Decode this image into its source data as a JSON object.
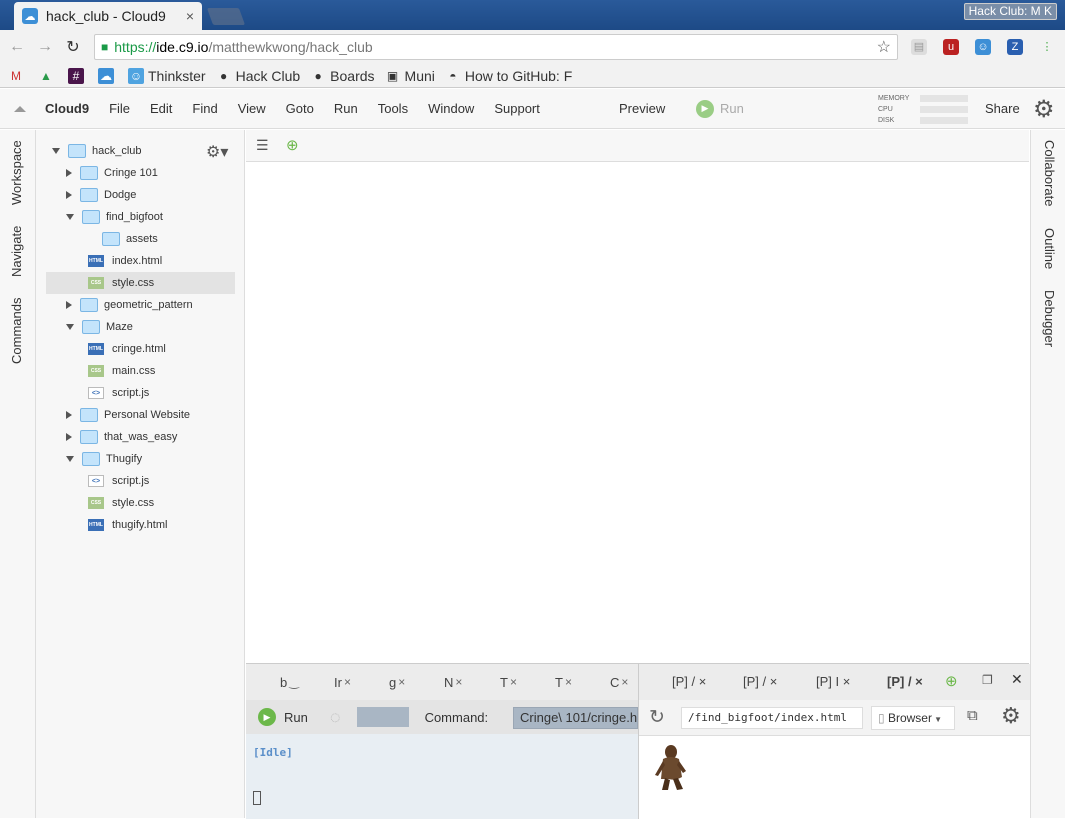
{
  "chrome": {
    "tab_title": "hack_club - Cloud9",
    "tab_close": "×",
    "profile": "Hack Club: M K",
    "url_https": "https://",
    "url_host": "ide.c9.io",
    "url_path": "/matthewkwong/hack_club"
  },
  "bookmarks": [
    {
      "label": "",
      "icon": "gmail-icon"
    },
    {
      "label": "",
      "icon": "drive-icon"
    },
    {
      "label": "",
      "icon": "slack-icon"
    },
    {
      "label": "",
      "icon": "cloud9-icon"
    },
    {
      "label": "Thinkster",
      "icon": "thinkster-icon"
    },
    {
      "label": "Hack Club",
      "icon": "github-icon"
    },
    {
      "label": "Boards",
      "icon": "github-icon"
    },
    {
      "label": "Muni",
      "icon": "muni-icon"
    },
    {
      "label": "How to GitHub: F",
      "icon": "incognito-icon"
    }
  ],
  "menu": {
    "brand": "Cloud9",
    "items": [
      "File",
      "Edit",
      "Find",
      "View",
      "Goto",
      "Run",
      "Tools",
      "Window",
      "Support"
    ],
    "preview": "Preview",
    "run": "Run",
    "share": "Share",
    "stats": [
      "MEMORY",
      "CPU",
      "DISK"
    ]
  },
  "left_tabs": [
    "Workspace",
    "Navigate",
    "Commands"
  ],
  "right_tabs": [
    "Collaborate",
    "Outline",
    "Debugger"
  ],
  "tree": [
    {
      "label": "hack_club",
      "kind": "folder",
      "depth": 0,
      "open": true
    },
    {
      "label": "Cringe 101",
      "kind": "folder",
      "depth": 1,
      "open": false
    },
    {
      "label": "Dodge",
      "kind": "folder",
      "depth": 1,
      "open": false
    },
    {
      "label": "find_bigfoot",
      "kind": "folder",
      "depth": 1,
      "open": true
    },
    {
      "label": "assets",
      "kind": "folder",
      "depth": 2
    },
    {
      "label": "index.html",
      "kind": "html",
      "depth": 2
    },
    {
      "label": "style.css",
      "kind": "css",
      "depth": 2,
      "selected": true
    },
    {
      "label": "geometric_pattern",
      "kind": "folder",
      "depth": 1,
      "open": false
    },
    {
      "label": "Maze",
      "kind": "folder",
      "depth": 1,
      "open": true
    },
    {
      "label": "cringe.html",
      "kind": "html",
      "depth": 2
    },
    {
      "label": "main.css",
      "kind": "css",
      "depth": 2
    },
    {
      "label": "script.js",
      "kind": "js",
      "depth": 2
    },
    {
      "label": "Personal Website",
      "kind": "folder",
      "depth": 1,
      "open": false
    },
    {
      "label": "that_was_easy",
      "kind": "folder",
      "depth": 1,
      "open": false
    },
    {
      "label": "Thugify",
      "kind": "folder",
      "depth": 1,
      "open": true
    },
    {
      "label": "script.js",
      "kind": "js",
      "depth": 2
    },
    {
      "label": "style.css",
      "kind": "css",
      "depth": 2
    },
    {
      "label": "thugify.html",
      "kind": "html",
      "depth": 2
    }
  ],
  "console_tabs": [
    "b",
    "Ir",
    "g",
    "N",
    "T",
    "T",
    "C"
  ],
  "run_panel": {
    "run": "Run",
    "command_label": "Command:",
    "command_value": "Cringe\\ 101/cringe.h",
    "idle": "[Idle]"
  },
  "browser_tabs": [
    "[P] /",
    "[P] /",
    "[P] I",
    "[P] /"
  ],
  "browser": {
    "url": "/find_bigfoot/index.html",
    "mode": "Browser"
  }
}
